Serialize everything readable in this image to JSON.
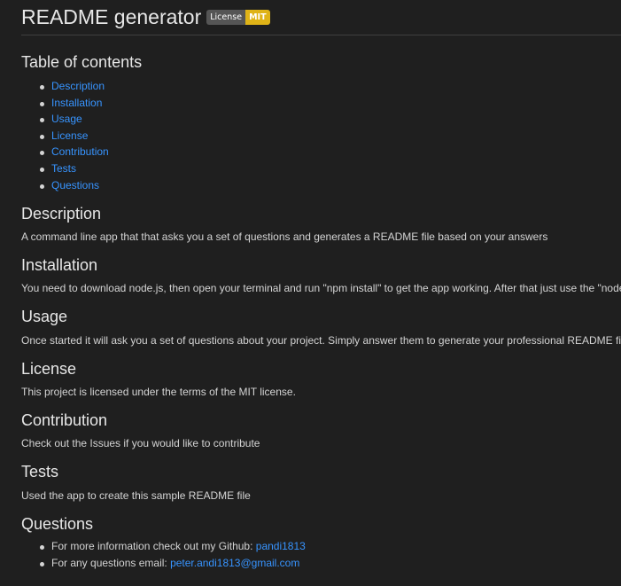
{
  "title": "README generator",
  "badge": {
    "label": "License",
    "value": "MIT",
    "value_color": "#dfb317"
  },
  "toc": {
    "heading": "Table of contents",
    "items": [
      {
        "label": "Description"
      },
      {
        "label": "Installation"
      },
      {
        "label": "Usage"
      },
      {
        "label": "License"
      },
      {
        "label": "Contribution"
      },
      {
        "label": "Tests"
      },
      {
        "label": "Questions"
      }
    ]
  },
  "sections": {
    "description": {
      "heading": "Description",
      "text": "A command line app that that asks you a set of questions and generates a README file based on your answers"
    },
    "installation": {
      "heading": "Installation",
      "text": "You need to download node.js, then open your terminal and run \"npm install\" to get the app working. After that just use the \"node i"
    },
    "usage": {
      "heading": "Usage",
      "text": "Once started it will ask you a set of questions about your project. Simply answer them to generate your professional README file."
    },
    "license": {
      "heading": "License",
      "text": "This project is licensed under the terms of the MIT license."
    },
    "contribution": {
      "heading": "Contribution",
      "text": "Check out the Issues if you would like to contribute"
    },
    "tests": {
      "heading": "Tests",
      "text": "Used the app to create this sample README file"
    },
    "questions": {
      "heading": "Questions",
      "github_text": "For more information check out my Github: ",
      "github_link": "pandi1813",
      "email_text": "For any questions email: ",
      "email_link": "peter.andi1813@gmail.com"
    }
  },
  "colors": {
    "background": "#1f1f1f",
    "text": "#d4d4d4",
    "heading": "#e7e7e7",
    "link": "#3794ff"
  }
}
